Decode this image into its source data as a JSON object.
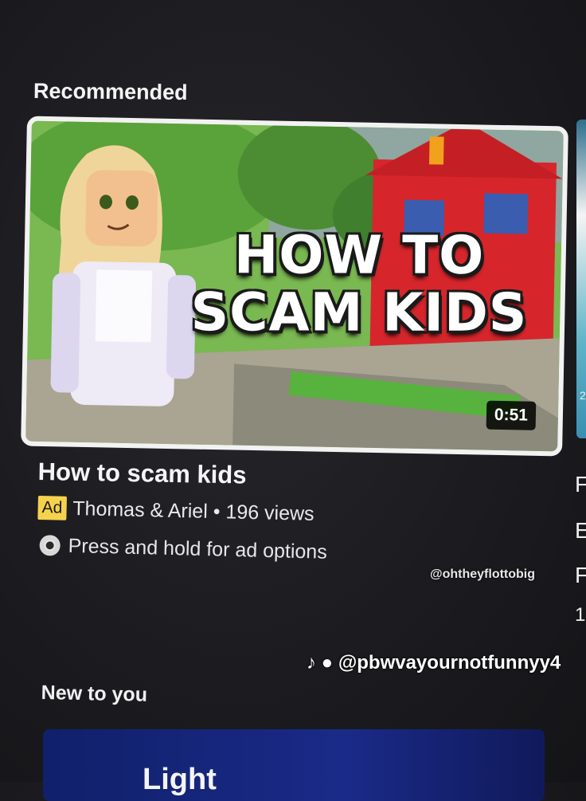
{
  "section_recommended": "Recommended",
  "video": {
    "thumbnail_text_line1": "HOW TO",
    "thumbnail_text_line2": "SCAM KIDS",
    "duration": "0:51",
    "title": "How to scam kids",
    "ad_label": "Ad",
    "channel": "Thomas & Ariel",
    "separator": "•",
    "views": "196 views",
    "ad_options": "Press and hold for ad options"
  },
  "section_new": "New to you",
  "bottom_card_text": "Light",
  "right_peek": [
    "F",
    "E",
    "F",
    "1",
    "2"
  ],
  "watermark": {
    "small": "@ohtheyflottobig",
    "main": "@pbwvayournotfunnyy4"
  },
  "colors": {
    "ad_badge": "#f6d24c",
    "background": "#1c1c20"
  }
}
